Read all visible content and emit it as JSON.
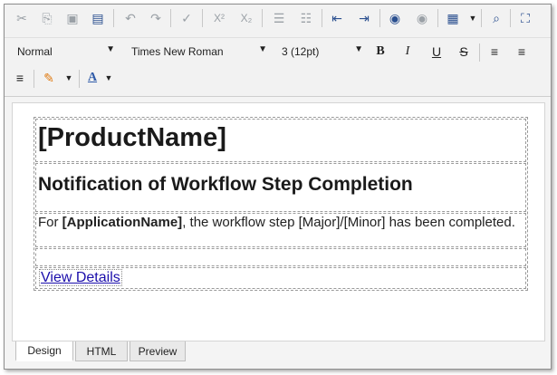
{
  "toolbar": {
    "row1": [
      {
        "name": "cut-icon",
        "glyph": "✂",
        "active": false
      },
      {
        "name": "copy-icon",
        "glyph": "⎘",
        "active": false
      },
      {
        "name": "paste-icon",
        "glyph": "📋",
        "active": false
      },
      {
        "name": "paste-from-word-icon",
        "glyph": "W",
        "active": true
      },
      {
        "name": "undo-icon",
        "glyph": "↶",
        "active": false
      },
      {
        "name": "redo-icon",
        "glyph": "↷",
        "active": false
      },
      {
        "name": "spellcheck-icon",
        "glyph": "✔",
        "active": false
      },
      {
        "name": "superscript-icon",
        "glyph": "X²",
        "active": false
      },
      {
        "name": "subscript-icon",
        "glyph": "X₂",
        "active": false
      },
      {
        "name": "numbered-list-icon",
        "glyph": "☰",
        "active": false
      },
      {
        "name": "bulleted-list-icon",
        "glyph": "☷",
        "active": false
      },
      {
        "name": "outdent-icon",
        "glyph": "⇤",
        "active": true
      },
      {
        "name": "indent-icon",
        "glyph": "⇥",
        "active": true
      },
      {
        "name": "insert-link-icon",
        "glyph": "🌐",
        "active": true
      },
      {
        "name": "remove-link-icon",
        "glyph": "🌐",
        "active": false
      },
      {
        "name": "table-icon",
        "glyph": "▦",
        "active": true
      },
      {
        "name": "find-icon",
        "glyph": "🔍",
        "active": true
      },
      {
        "name": "fullscreen-icon",
        "glyph": "⛶",
        "active": true
      }
    ],
    "format_select": "Normal",
    "font_select": "Times New Roman",
    "size_select": "3 (12pt)",
    "bold_label": "B",
    "italic_label": "I",
    "underline_label": "U",
    "strike_label": "S",
    "font_color_label": "A"
  },
  "document": {
    "title": "[ProductName]",
    "subtitle": "Notification of Workflow Step Completion",
    "para_prefix": "For ",
    "para_app": "[ApplicationName]",
    "para_suffix": ", the workflow step [Major]/[Minor] has been completed.",
    "link_text": "View Details"
  },
  "tabs": [
    {
      "label": "Design",
      "selected": true
    },
    {
      "label": "HTML",
      "selected": false
    },
    {
      "label": "Preview",
      "selected": false
    }
  ]
}
